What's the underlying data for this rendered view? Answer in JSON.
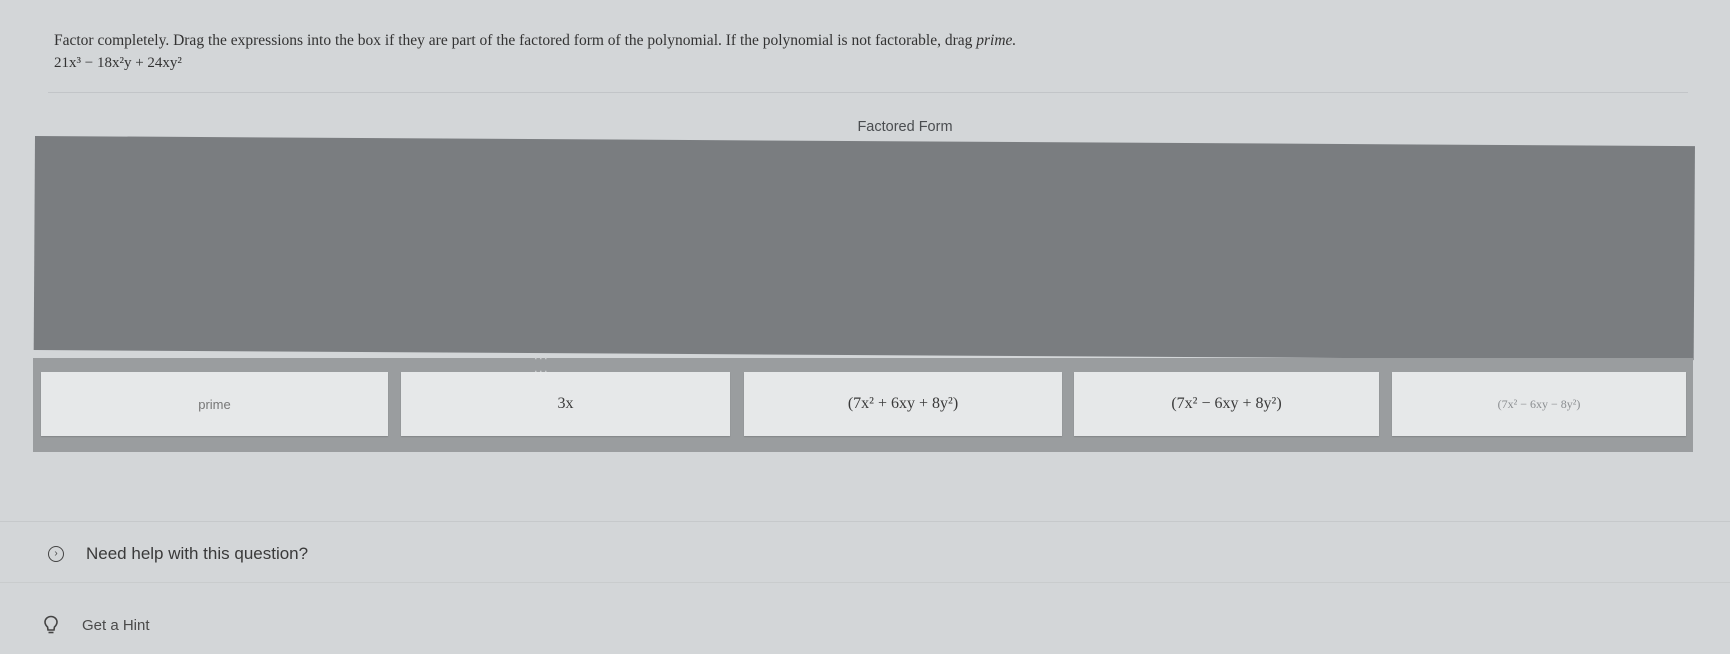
{
  "question": {
    "instruction": "Factor completely. Drag the expressions into the box if they are part of the factored form of the polynomial. If the polynomial is not factorable, drag ",
    "instruction_end": "prime.",
    "polynomial": "21x³ − 18x²y + 24xy²"
  },
  "factored_form": {
    "title": "Factored Form"
  },
  "tiles": [
    {
      "label": "prime"
    },
    {
      "label": "3x"
    },
    {
      "label": "(7x² + 6xy + 8y²)"
    },
    {
      "label": "(7x² − 6xy + 8y²)"
    },
    {
      "label": "(7x² − 6xy − 8y²)"
    }
  ],
  "help": {
    "label": "Need help with this question?"
  },
  "hint": {
    "label": "Get a Hint"
  },
  "icons": {
    "chevron": "chevron-right-circle-icon",
    "hint": "lightbulb-icon",
    "drag": "drag-handle-icon"
  }
}
